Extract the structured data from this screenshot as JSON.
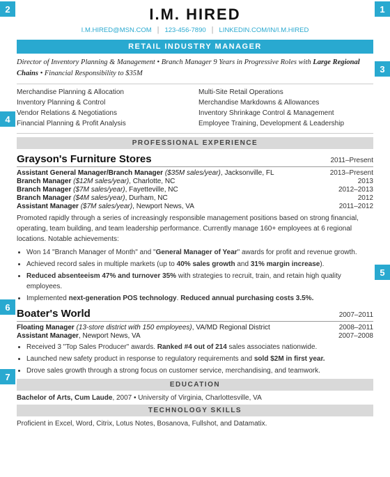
{
  "side_labels": [
    "2",
    "1",
    "3",
    "4",
    "5",
    "6",
    "7"
  ],
  "header": {
    "name": "I.M. HIRED",
    "email": "I.M.HIRED@MSN.COM",
    "phone": "123-456-7890",
    "linkedin": "LINKEDIN.COM/IN/I.M.HIRED",
    "title": "RETAIL INDUSTRY MANAGER"
  },
  "summary": {
    "text": "Director of Inventory Planning & Management • Branch Manager 9 Years in Progressive Roles with Large Regional Chains • Financial Responsibility to $35M"
  },
  "skills": [
    "Merchandise Planning & Allocation",
    "Multi-Site Retail Operations",
    "Inventory Planning & Control",
    "Merchandise Markdowns & Allowances",
    "Vendor Relations & Negotiations",
    "Inventory Shrinkage Control & Management",
    "Financial Planning & Profit Analysis",
    "Employee Training, Development & Leadership"
  ],
  "sections": {
    "experience_label": "PROFESSIONAL EXPERIENCE",
    "education_label": "EDUCATION",
    "technology_label": "TECHNOLOGY SKILLS"
  },
  "experience": [
    {
      "company": "Grayson's Furniture Stores",
      "dates": "2011–Present",
      "roles": [
        {
          "title": "Assistant General Manager/Branch Manager",
          "detail": "($35M sales/year), Jacksonville, FL",
          "dates": "2013–Present"
        },
        {
          "title": "Branch Manager",
          "detail": "($12M sales/year), Charlotte, NC",
          "dates": "2013"
        },
        {
          "title": "Branch Manager",
          "detail": "($7M sales/year), Fayetteville, NC",
          "dates": "2012–2013"
        },
        {
          "title": "Branch Manager",
          "detail": "($4M sales/year), Durham, NC",
          "dates": "2012"
        },
        {
          "title": "Assistant Manager",
          "detail": "($7M sales/year), Newport News, VA",
          "dates": "2011–2012"
        }
      ],
      "description": "Promoted rapidly through a series of increasingly responsible management positions based on strong financial, operating, team building, and team leadership performance. Currently manage 160+ employees at 6 regional locations. Notable achievements:",
      "bullets": [
        "Won 14 \"Branch Manager of Month\" and \"General Manager of Year\" awards for profit and revenue growth.",
        "Achieved record sales in multiple markets (up to 40% sales growth and 31% margin increase).",
        "Reduced absenteeism 47% and turnover 35% with strategies to recruit, train, and retain high quality employees.",
        "Implemented next-generation POS technology. Reduced annual purchasing costs 3.5%."
      ]
    },
    {
      "company": "Boater's World",
      "dates": "2007–2011",
      "roles": [
        {
          "title": "Floating Manager",
          "detail": "(13-store district with 150 employees), VA/MD Regional District",
          "dates": "2008–2011"
        },
        {
          "title": "Assistant Manager",
          "detail": "Newport News, VA",
          "dates": "2007–2008"
        }
      ],
      "description": "",
      "bullets": [
        "Received 3 \"Top Sales Producer\" awards. Ranked #4 out of 214 sales associates nationwide.",
        "Launched new safety product in response to regulatory requirements and sold $2M in first year.",
        "Drove sales growth through a strong focus on customer service, merchandising, and teamwork."
      ]
    }
  ],
  "education": {
    "degree": "Bachelor of Arts, Cum Laude",
    "year": "2007",
    "school": "University of Virginia, Charlottesville, VA"
  },
  "technology": {
    "text": "Proficient in Excel, Word, Citrix, Lotus Notes, Bosanova, Fullshot, and Datamatix."
  }
}
